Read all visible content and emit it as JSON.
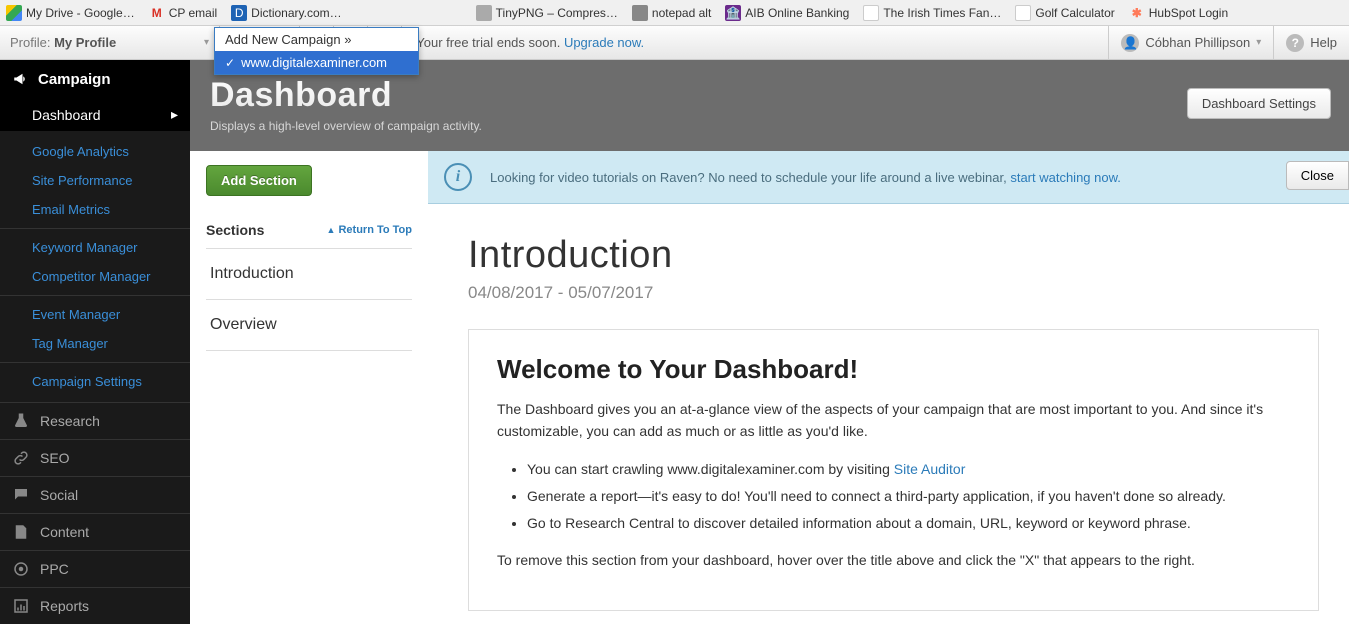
{
  "bookmarks": [
    {
      "label": "My Drive - Google…"
    },
    {
      "label": "CP email"
    },
    {
      "label": "Dictionary.com…"
    },
    {
      "label": "TinyPNG – Compres…"
    },
    {
      "label": "notepad alt"
    },
    {
      "label": "AIB Online Banking"
    },
    {
      "label": "The Irish Times Fan…"
    },
    {
      "label": "Golf Calculator"
    },
    {
      "label": "HubSpot Login"
    }
  ],
  "profile": {
    "prefix": "Profile: ",
    "name": "My Profile"
  },
  "campaign_label": "Campaign",
  "dropdown": {
    "add": "Add New Campaign »",
    "selected": "www.digitalexaminer.com"
  },
  "trial": {
    "text": "Your free trial ends soon. ",
    "link": "Upgrade now."
  },
  "user": "Cóbhan Phillipson",
  "help": "Help",
  "sidebar": {
    "campaign": "Campaign",
    "dashboard": "Dashboard",
    "groups": [
      [
        "Google Analytics",
        "Site Performance",
        "Email Metrics"
      ],
      [
        "Keyword Manager",
        "Competitor Manager"
      ],
      [
        "Event Manager",
        "Tag Manager"
      ],
      [
        "Campaign Settings"
      ]
    ],
    "cats": [
      "Research",
      "SEO",
      "Social",
      "Content",
      "PPC",
      "Reports"
    ]
  },
  "header": {
    "title": "Dashboard",
    "subtitle": "Displays a high-level overview of campaign activity.",
    "settings": "Dashboard Settings"
  },
  "addSection": "Add Section",
  "sectionsLabel": "Sections",
  "returnTop": "Return To Top",
  "sectionItems": [
    "Introduction",
    "Overview"
  ],
  "notice": {
    "text1": "Looking for video tutorials on Raven? No need to schedule your life around a live webinar, ",
    "link": "start watching now.",
    "close": "Close"
  },
  "intro": {
    "title": "Introduction",
    "range": "04/08/2017 - 05/07/2017",
    "welcome": "Welcome to Your Dashboard!",
    "p1": "The Dashboard gives you an at-a-glance view of the aspects of your campaign that are most important to you. And since it's customizable, you can add as much or as little as you'd like.",
    "li1a": "You can start crawling www.digitalexaminer.com by visiting ",
    "li1link": "Site Auditor",
    "li2": "Generate a report—it's easy to do! You'll need to connect a third-party application, if you haven't done so already.",
    "li3": "Go to Research Central to discover detailed information about a domain, URL, keyword or keyword phrase.",
    "p2": "To remove this section from your dashboard, hover over the title above and click the \"X\" that appears to the right."
  }
}
